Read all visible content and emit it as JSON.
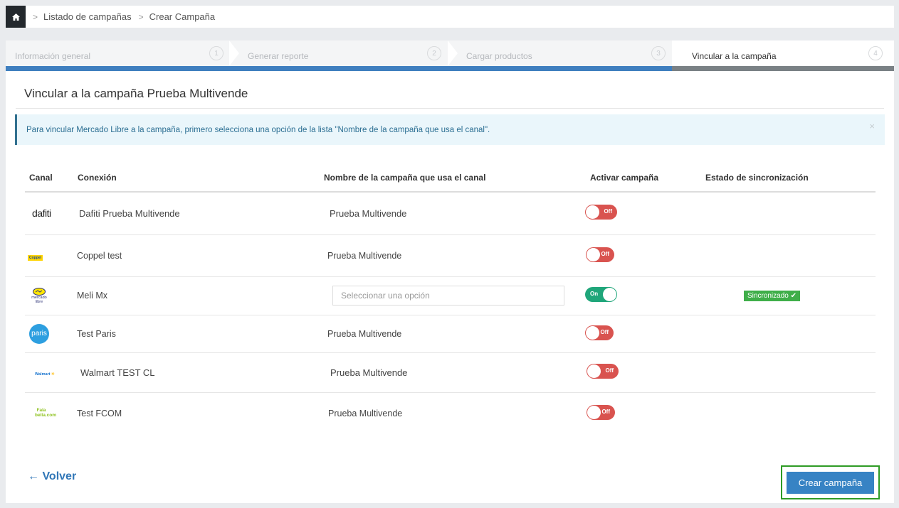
{
  "breadcrumb": {
    "items": [
      "Listado de campañas",
      "Crear Campaña"
    ]
  },
  "steps": [
    {
      "label": "Información general",
      "number": "1",
      "state": "complete"
    },
    {
      "label": "Generar reporte",
      "number": "2",
      "state": "complete"
    },
    {
      "label": "Cargar productos",
      "number": "3",
      "state": "complete"
    },
    {
      "label": "Vincular a la campaña",
      "number": "4",
      "state": "active"
    }
  ],
  "page": {
    "title": "Vincular a la campaña Prueba Multivende"
  },
  "alert": {
    "text": "Para vincular Mercado Libre a la campaña, primero selecciona una opción de la lista \"Nombre de la campaña que usa el canal\".",
    "close": "×"
  },
  "table": {
    "headers": [
      "Canal",
      "Conexión",
      "Nombre de la campaña que usa el canal",
      "Activar campaña",
      "Estado de sincronización"
    ],
    "rows": [
      {
        "channel_logo": "dafiti",
        "connection": "Dafiti Prueba Multivende",
        "campaign": "Prueba Multivende",
        "toggle": "Off",
        "sync": ""
      },
      {
        "channel_logo": "Coppel",
        "connection": "Coppel test",
        "campaign": "Prueba Multivende",
        "toggle": "Off",
        "sync": ""
      },
      {
        "channel_logo": "mercado libre",
        "connection": "Meli Mx",
        "campaign_placeholder": "Seleccionar una opción",
        "toggle": "On",
        "sync": "Sincronizado ✔"
      },
      {
        "channel_logo": "paris",
        "connection": "Test Paris",
        "campaign": "Prueba Multivende",
        "toggle": "Off",
        "sync": ""
      },
      {
        "channel_logo": "Walmart",
        "connection": "Walmart TEST CL",
        "campaign": "Prueba Multivende",
        "toggle": "Off",
        "sync": ""
      },
      {
        "channel_logo": "Fala bella.com",
        "connection": "Test FCOM",
        "campaign": "Prueba Multivende",
        "toggle": "Off",
        "sync": ""
      }
    ]
  },
  "footer": {
    "back_label": "← Volver",
    "create_label": "Crear campaña"
  },
  "colors": {
    "primary": "#3783c4",
    "toggle_off": "#d9534f",
    "toggle_on": "#1fa67a",
    "sync_badge": "#3fae49",
    "cta_outline": "#2e9b25"
  }
}
